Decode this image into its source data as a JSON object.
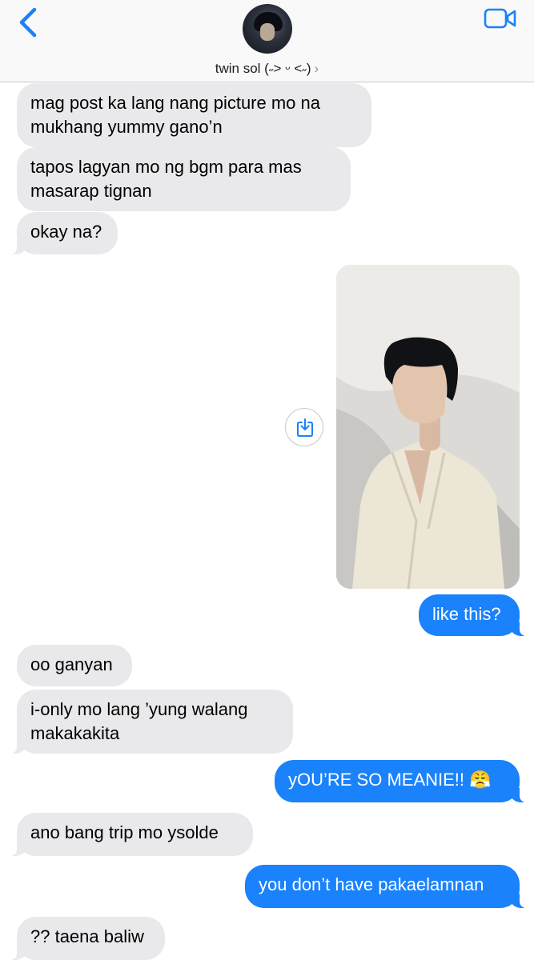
{
  "header": {
    "contact_name": "twin sol (˶˃ ᵕ ˂˶)",
    "chevron": "›",
    "icons": {
      "back": "chevron-left-icon",
      "video": "video-camera-icon"
    },
    "accent_color": "#1a82fb"
  },
  "messages": [
    {
      "from": "them",
      "text": "mag post ka lang nang picture mo na mukhang yummy gano’n"
    },
    {
      "from": "them",
      "text": "tapos lagyan mo ng bgm para mas masarap tignan"
    },
    {
      "from": "them",
      "text": "okay na?"
    },
    {
      "from": "me",
      "type": "image",
      "alt": ""
    },
    {
      "from": "me",
      "text": "like this?"
    },
    {
      "from": "them",
      "text": "oo ganyan"
    },
    {
      "from": "them",
      "text": "i-only mo lang ’yung walang makakakita"
    },
    {
      "from": "me",
      "text": "yOU’RE SO MEANIE!! 😤"
    },
    {
      "from": "them",
      "text": "ano bang trip mo ysolde"
    },
    {
      "from": "me",
      "text": "you don’t have pakaelamnan"
    },
    {
      "from": "them",
      "text": "?? taena baliw"
    }
  ],
  "colors": {
    "incoming_bubble": "#e9e9eb",
    "outgoing_bubble": "#1a82fb"
  }
}
